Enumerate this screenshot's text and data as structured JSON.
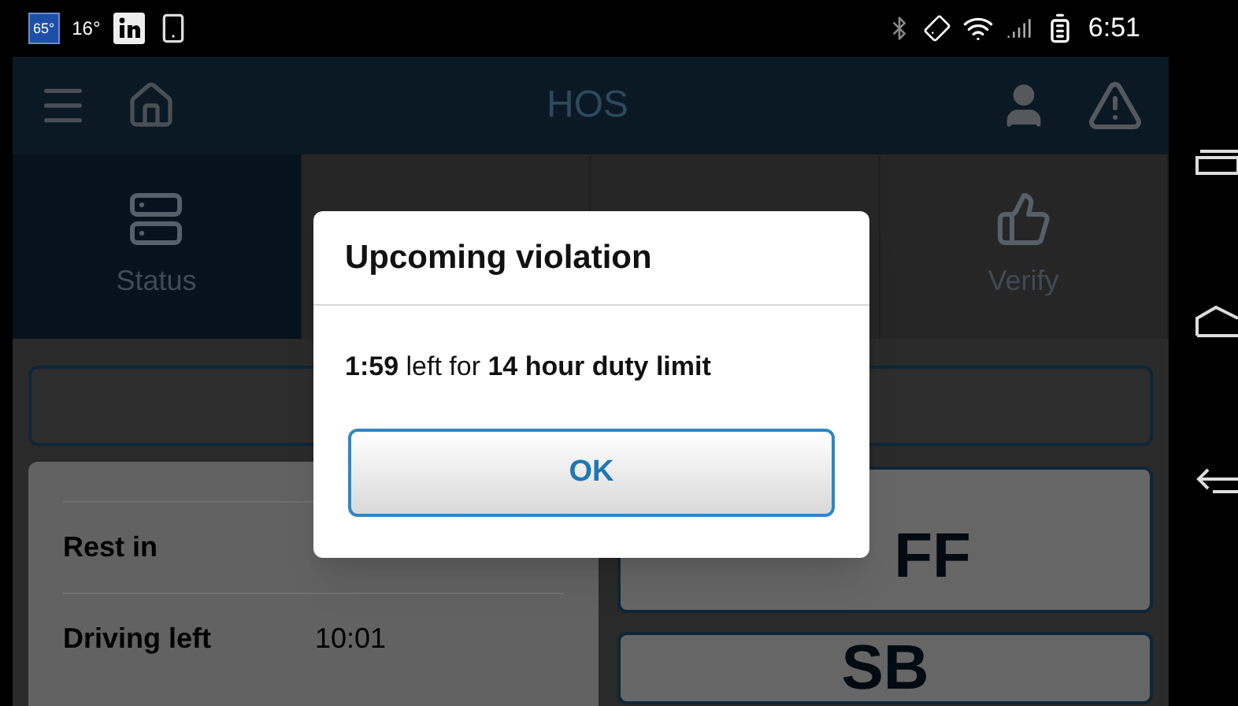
{
  "status_bar": {
    "weather_badge": "65°",
    "temperature": "16°",
    "time": "6:51"
  },
  "app_bar": {
    "title": "HOS"
  },
  "tabs": [
    {
      "label": "Status",
      "selected": true,
      "kind": "status"
    },
    {
      "selected": false,
      "kind": "logs"
    },
    {
      "selected": false,
      "kind": "list"
    },
    {
      "label": "Verify",
      "selected": false,
      "kind": "verify"
    }
  ],
  "summary": [
    {
      "label": "Rest in"
    },
    {
      "label": "Driving left",
      "value": "10:01"
    }
  ],
  "duty_buttons": [
    {
      "label": "FF"
    },
    {
      "label": "SB"
    }
  ],
  "dialog": {
    "title": "Upcoming violation",
    "message": "**1:59** left for **14 hour duty limit**",
    "button": "OK"
  }
}
